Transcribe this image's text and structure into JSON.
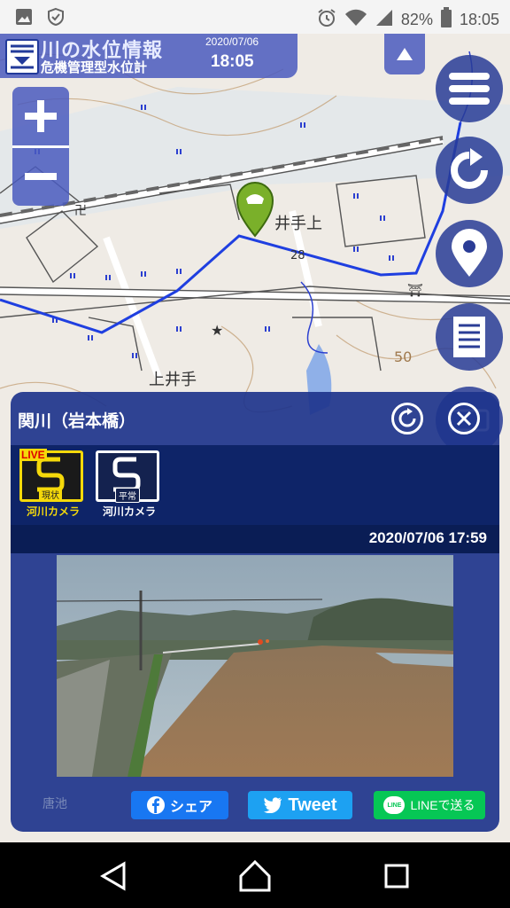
{
  "status_bar": {
    "battery": "82%",
    "time": "18:05",
    "icons": [
      "image-icon",
      "shield-check-icon",
      "alarm-icon",
      "wifi-icon",
      "signal-icon",
      "battery-icon"
    ]
  },
  "header": {
    "title": "川の水位情報",
    "subtitle": "危機管理型水位計",
    "date": "2020/07/06",
    "time": "18:05"
  },
  "map": {
    "labels": {
      "place_upper": "井手上",
      "place_lower": "上井手",
      "elev_50": "50",
      "elev_28": "28",
      "temple": "卍",
      "shrine": "⛩",
      "bottom_place": "唐池"
    },
    "river_color": "#1f3fe0"
  },
  "panel": {
    "title": "関川（岩本橋）",
    "cameras": [
      {
        "badge": "LIVE",
        "sub": "現状",
        "label": "河川カメラ",
        "color": "#f5d90a"
      },
      {
        "badge": "",
        "sub": "平常",
        "label": "河川カメラ",
        "color": "#ffffff"
      }
    ],
    "timestamp": "2020/07/06 17:59"
  },
  "share": {
    "facebook": "シェア",
    "twitter": "Tweet",
    "line": "LINEで送る",
    "line_logo": "LINE",
    "facebook_color": "#1877f2",
    "twitter_color": "#1da1f2",
    "line_color": "#06c755"
  }
}
